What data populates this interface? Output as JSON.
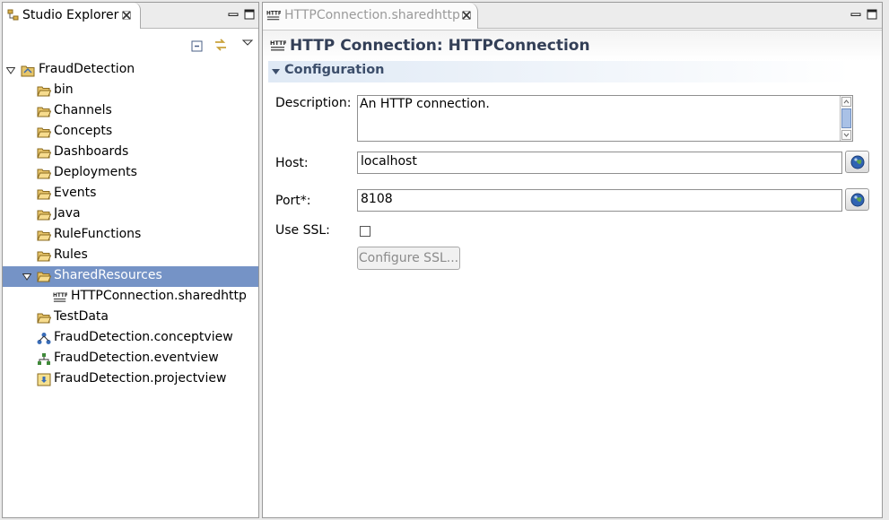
{
  "explorer": {
    "tab_label": "Studio Explorer",
    "tree": {
      "root": "FraudDetection",
      "folders": [
        "bin",
        "Channels",
        "Concepts",
        "Dashboards",
        "Deployments",
        "Events",
        "Java",
        "RuleFunctions",
        "Rules"
      ],
      "selected_folder": "SharedResources",
      "shared_child": "HTTPConnection.sharedhttp",
      "test_data": "TestData",
      "views": [
        "FraudDetection.conceptview",
        "FraudDetection.eventview",
        "FraudDetection.projectview"
      ]
    }
  },
  "editor": {
    "tab_label": "HTTPConnection.sharedhttp",
    "icon_text": "HTTP",
    "form_title": "HTTP Connection: HTTPConnection",
    "section_title": "Configuration",
    "description_label": "Description:",
    "description_value": "An HTTP connection.",
    "host_label": "Host:",
    "host_value": "localhost",
    "port_label": "Port*:",
    "port_value": "8108",
    "ssl_label": "Use SSL:",
    "ssl_checked": false,
    "configure_ssl_label": "Configure SSL..."
  },
  "colors": {
    "selection": "#7593c6",
    "title_text": "#333f57",
    "section_text": "#3c4e6b"
  },
  "icons": [
    "explorer-view-icon",
    "close-icon",
    "minimize-icon",
    "maximize-icon",
    "collapse-all-icon",
    "link-with-editor-icon",
    "view-menu-icon",
    "project-icon",
    "folder-icon",
    "http-resource-icon",
    "concept-view-icon",
    "event-view-icon",
    "project-view-icon",
    "globe-icon",
    "chevron-down-icon"
  ]
}
